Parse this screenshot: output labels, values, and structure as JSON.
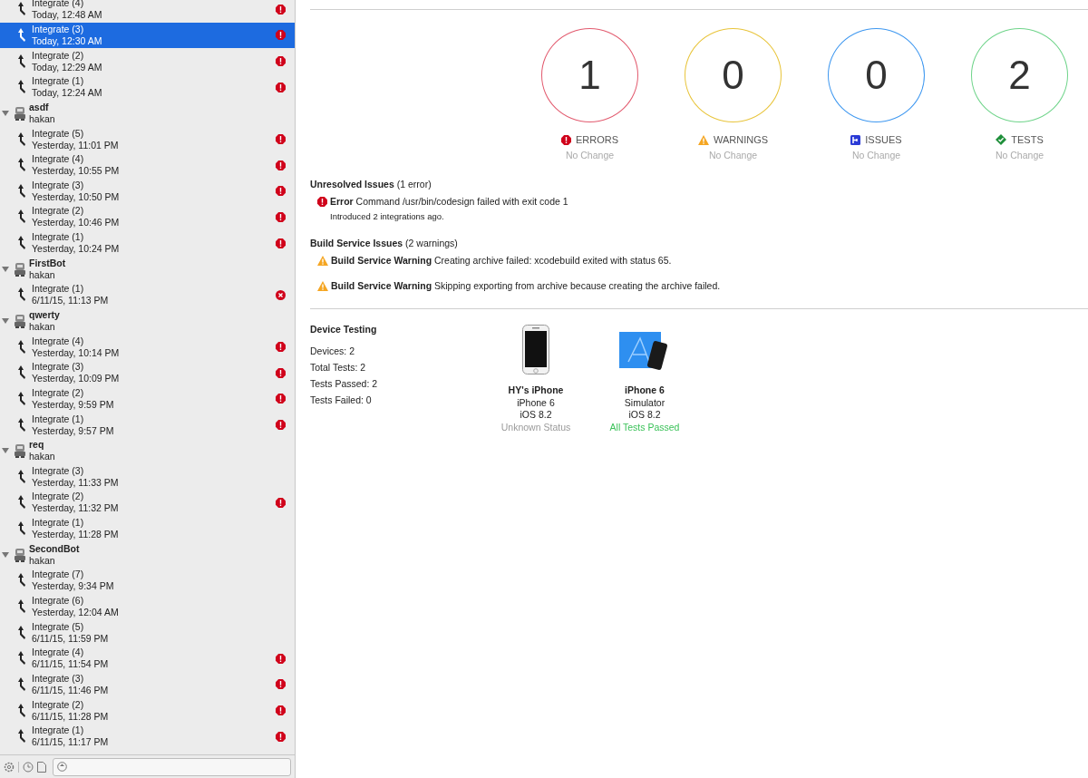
{
  "sidebar": {
    "groups": [
      {
        "children": [
          {
            "title": "Integrate (4)",
            "time": "Today, 12:48 AM",
            "kind": "error",
            "selected": false
          },
          {
            "title": "Integrate (3)",
            "time": "Today, 12:30 AM",
            "kind": "error",
            "selected": true
          },
          {
            "title": "Integrate (2)",
            "time": "Today, 12:29 AM",
            "kind": "error",
            "selected": false
          },
          {
            "title": "Integrate (1)",
            "time": "Today, 12:24 AM",
            "kind": "error",
            "selected": false
          }
        ]
      },
      {
        "name": "asdf",
        "owner": "hakan",
        "expanded": true,
        "children": [
          {
            "title": "Integrate (5)",
            "time": "Yesterday, 11:01 PM",
            "kind": "error",
            "selected": false
          },
          {
            "title": "Integrate (4)",
            "time": "Yesterday, 10:55 PM",
            "kind": "error",
            "selected": false
          },
          {
            "title": "Integrate (3)",
            "time": "Yesterday, 10:50 PM",
            "kind": "error",
            "selected": false
          },
          {
            "title": "Integrate (2)",
            "time": "Yesterday, 10:46 PM",
            "kind": "error",
            "selected": false
          },
          {
            "title": "Integrate (1)",
            "time": "Yesterday, 10:24 PM",
            "kind": "error",
            "selected": false
          }
        ]
      },
      {
        "name": "FirstBot",
        "owner": "hakan",
        "expanded": true,
        "children": [
          {
            "title": "Integrate (1)",
            "time": "6/11/15, 11:13 PM",
            "kind": "failed",
            "selected": false
          }
        ]
      },
      {
        "name": "qwerty",
        "owner": "hakan",
        "expanded": true,
        "children": [
          {
            "title": "Integrate (4)",
            "time": "Yesterday, 10:14 PM",
            "kind": "error",
            "selected": false
          },
          {
            "title": "Integrate (3)",
            "time": "Yesterday, 10:09 PM",
            "kind": "error",
            "selected": false
          },
          {
            "title": "Integrate (2)",
            "time": "Yesterday, 9:59 PM",
            "kind": "error",
            "selected": false
          },
          {
            "title": "Integrate (1)",
            "time": "Yesterday, 9:57 PM",
            "kind": "error",
            "selected": false
          }
        ]
      },
      {
        "name": "req",
        "owner": "hakan",
        "expanded": true,
        "children": [
          {
            "title": "Integrate (3)",
            "time": "Yesterday, 11:33 PM",
            "kind": "plain",
            "selected": false
          },
          {
            "title": "Integrate (2)",
            "time": "Yesterday, 11:32 PM",
            "kind": "error",
            "selected": false
          },
          {
            "title": "Integrate (1)",
            "time": "Yesterday, 11:28 PM",
            "kind": "plain",
            "selected": false
          }
        ]
      },
      {
        "name": "SecondBot",
        "owner": "hakan",
        "expanded": true,
        "children": [
          {
            "title": "Integrate (7)",
            "time": "Yesterday, 9:34 PM",
            "kind": "plain",
            "selected": false
          },
          {
            "title": "Integrate (6)",
            "time": "Yesterday, 12:04 AM",
            "kind": "plain",
            "selected": false
          },
          {
            "title": "Integrate (5)",
            "time": "6/11/15, 11:59 PM",
            "kind": "plain",
            "selected": false
          },
          {
            "title": "Integrate (4)",
            "time": "6/11/15, 11:54 PM",
            "kind": "error",
            "selected": false
          },
          {
            "title": "Integrate (3)",
            "time": "6/11/15, 11:46 PM",
            "kind": "error",
            "selected": false
          },
          {
            "title": "Integrate (2)",
            "time": "6/11/15, 11:28 PM",
            "kind": "error",
            "selected": false
          },
          {
            "title": "Integrate (1)",
            "time": "6/11/15, 11:17 PM",
            "kind": "error",
            "selected": false
          }
        ]
      }
    ]
  },
  "summary": [
    {
      "kind": "error",
      "count": "1",
      "label": "ERRORS",
      "change": "No Change",
      "color": "#e25a6e"
    },
    {
      "kind": "warning",
      "count": "0",
      "label": "WARNINGS",
      "change": "No Change",
      "color": "#e8c43a"
    },
    {
      "kind": "issue",
      "count": "0",
      "label": "ISSUES",
      "change": "No Change",
      "color": "#3d97f0"
    },
    {
      "kind": "test",
      "count": "2",
      "label": "TESTS",
      "change": "No Change",
      "color": "#6fd48a"
    }
  ],
  "issue_sections": [
    {
      "heading": "**Unresolved Issues** (1 error)",
      "issues": [
        {
          "kind": "error",
          "text": "**Error** Command /usr/bin/codesign failed with exit code 1",
          "note": "Introduced 2 integrations ago."
        }
      ]
    },
    {
      "heading": "**Build Service Issues** (2 warnings)",
      "issues": [
        {
          "kind": "warning",
          "text": "**Build Service Warning** Creating archive failed: xcodebuild exited with status 65."
        },
        {
          "kind": "warning",
          "text": "**Build Service Warning** Skipping exporting from archive because creating the archive failed."
        }
      ]
    }
  ],
  "device_testing": {
    "title": "Device Testing",
    "stats": [
      "Devices: 2",
      "Total Tests: 2",
      "Tests Passed: 2",
      "Tests Failed: 0"
    ],
    "devices": [
      {
        "kind": "device",
        "name": "HY's iPhone",
        "model": "iPhone 6",
        "os": "iOS 8.2",
        "status": "Unknown Status",
        "color": "#9a9a9a"
      },
      {
        "kind": "simulator",
        "name": "iPhone 6",
        "model": "Simulator",
        "os": "iOS 8.2",
        "status": "All Tests Passed",
        "color": "#3cc25a"
      }
    ]
  }
}
